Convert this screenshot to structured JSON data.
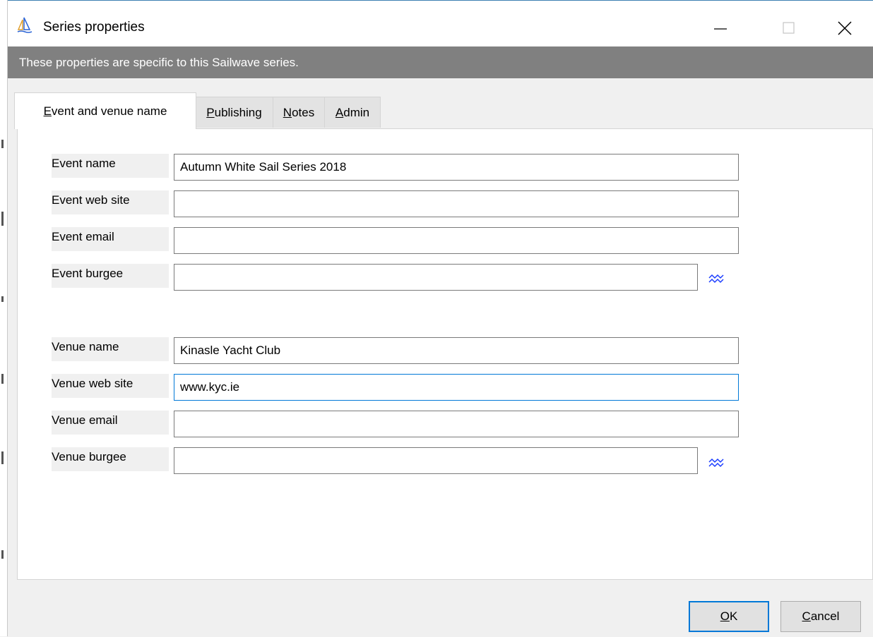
{
  "window": {
    "title": "Series properties",
    "icon": "sailboat-icon"
  },
  "banner": {
    "text": "These properties are specific to this Sailwave series."
  },
  "tabs": [
    {
      "label_accel": "E",
      "label_rest": "vent and venue name",
      "active": true
    },
    {
      "label_accel": "P",
      "label_rest": "ublishing",
      "active": false
    },
    {
      "label_accel": "N",
      "label_rest": "otes",
      "active": false
    },
    {
      "label_accel": "A",
      "label_rest": "dmin",
      "active": false
    }
  ],
  "fields": {
    "event_name": {
      "label": "Event name",
      "value": "Autumn White Sail Series 2018"
    },
    "event_web_site": {
      "label": "Event web site",
      "value": ""
    },
    "event_email": {
      "label": "Event email",
      "value": ""
    },
    "event_burgee": {
      "label": "Event burgee",
      "value": ""
    },
    "venue_name": {
      "label": "Venue name",
      "value": "Kinasle Yacht Club"
    },
    "venue_web_site": {
      "label": "Venue web site",
      "value": "www.kyc.ie"
    },
    "venue_email": {
      "label": "Venue email",
      "value": ""
    },
    "venue_burgee": {
      "label": "Venue burgee",
      "value": ""
    }
  },
  "buttons": {
    "ok_accel": "O",
    "ok_rest": "K",
    "cancel_accel": "C",
    "cancel_rest": "ancel"
  },
  "colors": {
    "banner_bg": "#808080",
    "focus_border": "#0078d7",
    "burgee_icon": "#1a3cff"
  }
}
